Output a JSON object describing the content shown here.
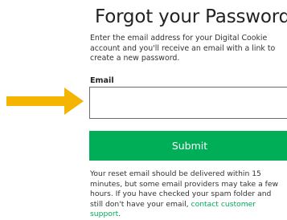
{
  "page": {
    "title": "Forgot your Password?",
    "intro": "Enter the email address for your Digital Cookie account and you'll receive an email with a link to create a new password."
  },
  "form": {
    "email_label": "Email",
    "email_value": "",
    "email_placeholder": "",
    "submit_label": "Submit"
  },
  "note": {
    "text_before_link": "Your reset email should be delivered within 15 minutes, but some email providers may take a few hours. If you have checked your spam folder and still don't have your email, ",
    "link_text": "contact customer support",
    "text_after_link": "."
  },
  "colors": {
    "accent_green": "#00ae58",
    "arrow_yellow": "#f5b400"
  },
  "icons": {
    "pointer": "right-arrow-icon"
  }
}
